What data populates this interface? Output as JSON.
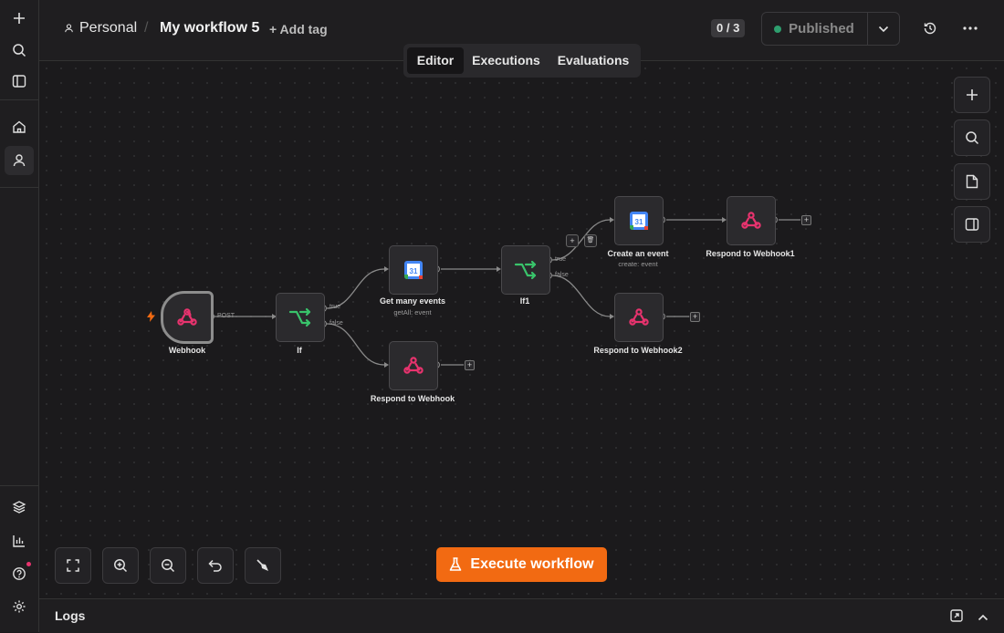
{
  "sidebar": {
    "items": [
      {
        "name": "plus-icon"
      },
      {
        "name": "search-icon"
      },
      {
        "name": "panel-icon"
      },
      {
        "name": "home-icon"
      },
      {
        "name": "user-icon"
      },
      {
        "name": "templates-icon"
      },
      {
        "name": "insights-icon"
      },
      {
        "name": "help-icon"
      },
      {
        "name": "settings-icon"
      }
    ]
  },
  "header": {
    "project": "Personal",
    "separator": "/",
    "workflow_title": "My workflow 5",
    "add_tag": "+ Add tag",
    "counter": "0 / 3",
    "publish_label": "Published"
  },
  "tabs": [
    {
      "label": "Editor",
      "active": true
    },
    {
      "label": "Executions",
      "active": false
    },
    {
      "label": "Evaluations",
      "active": false
    }
  ],
  "nodes": {
    "webhook": {
      "label": "Webhook",
      "port": "POST"
    },
    "if": {
      "label": "If",
      "true": "true",
      "false": "false"
    },
    "get_events": {
      "label": "Get many events",
      "sub": "getAll: event"
    },
    "respond": {
      "label": "Respond to Webhook"
    },
    "if1": {
      "label": "If1",
      "true": "true",
      "false": "false"
    },
    "create_event": {
      "label": "Create an event",
      "sub": "create: event"
    },
    "respond1": {
      "label": "Respond to Webhook1"
    },
    "respond2": {
      "label": "Respond to Webhook2"
    },
    "calendar_day": "31"
  },
  "edge_tools": {
    "add": "+",
    "delete": "🗑"
  },
  "execute_button": "Execute workflow",
  "logs": {
    "label": "Logs"
  },
  "colors": {
    "accent": "#f26a12",
    "webhook": "#e8336e",
    "if": "#39c46b",
    "published": "#2e9e6e"
  }
}
